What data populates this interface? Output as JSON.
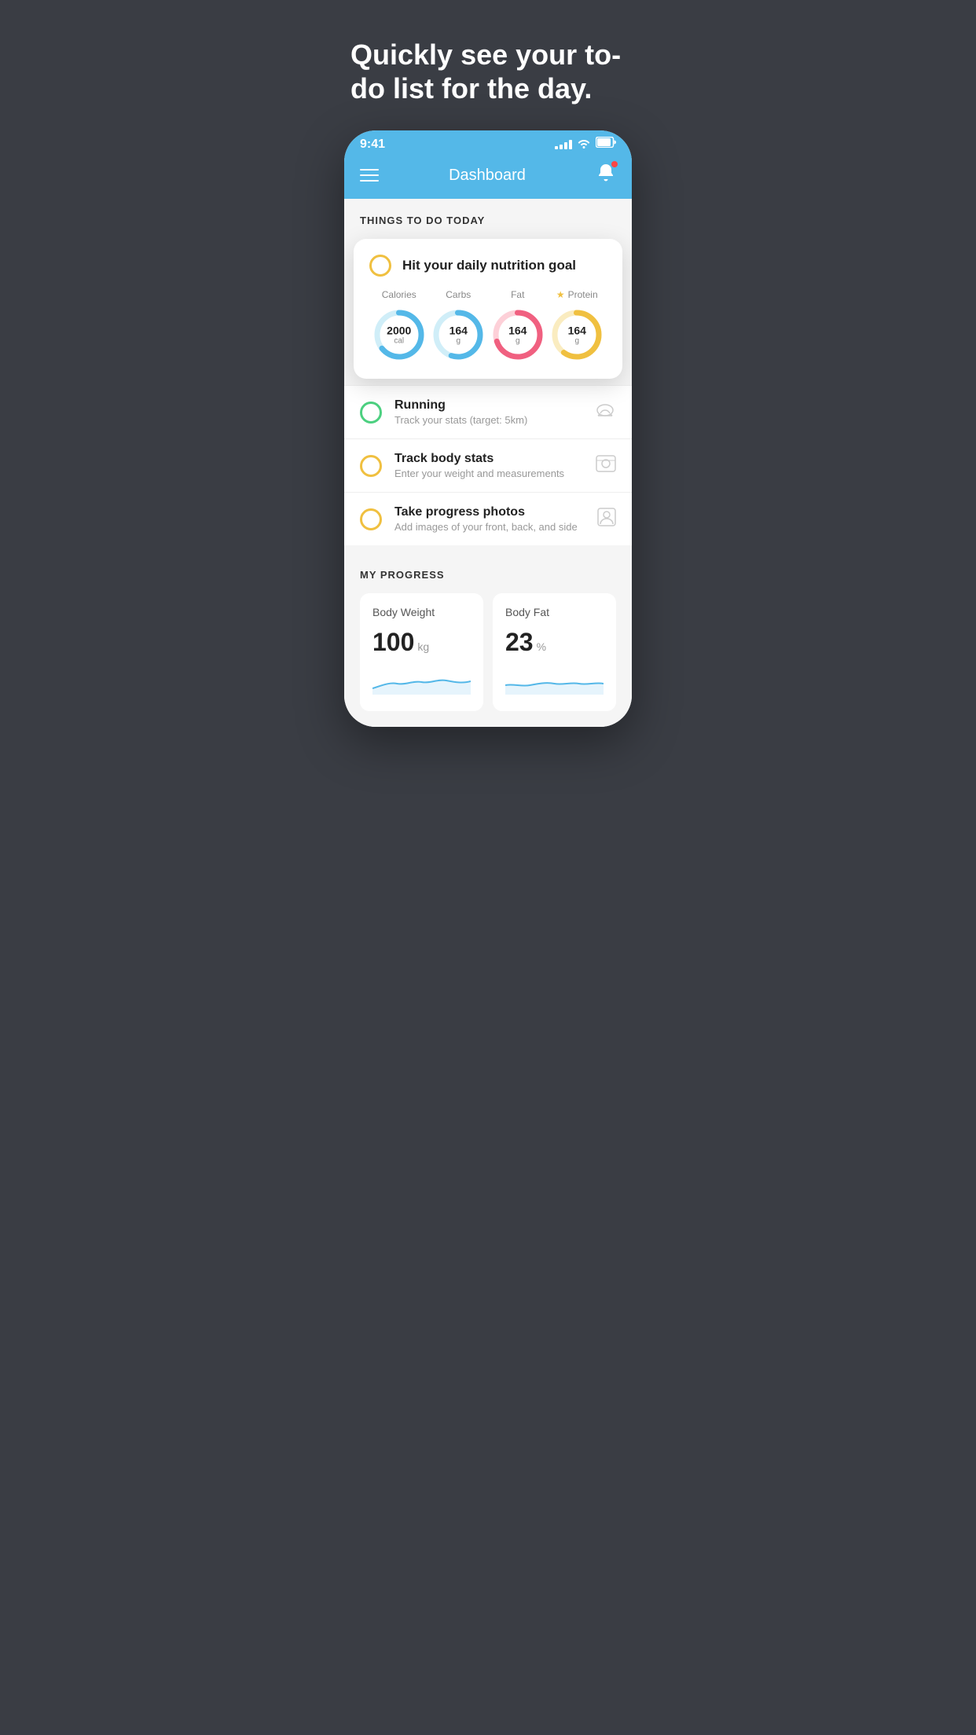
{
  "hero": {
    "title": "Quickly see your to-do list for the day."
  },
  "statusBar": {
    "time": "9:41",
    "signalBars": [
      3,
      5,
      7,
      9,
      11
    ],
    "battery": "■■■"
  },
  "nav": {
    "title": "Dashboard",
    "menuAriaLabel": "Menu",
    "bellAriaLabel": "Notifications"
  },
  "thingsToDo": {
    "sectionHeader": "THINGS TO DO TODAY",
    "floatingCard": {
      "checkboxColor": "yellow",
      "title": "Hit your daily nutrition goal",
      "items": [
        {
          "label": "Calories",
          "star": false,
          "value": "2000",
          "unit": "cal",
          "progress": 65,
          "color": "#54b8e8",
          "trackColor": "#d0eef8"
        },
        {
          "label": "Carbs",
          "star": false,
          "value": "164",
          "unit": "g",
          "progress": 55,
          "color": "#54b8e8",
          "trackColor": "#d0eef8"
        },
        {
          "label": "Fat",
          "star": false,
          "value": "164",
          "unit": "g",
          "progress": 70,
          "color": "#f06080",
          "trackColor": "#fdd0d8"
        },
        {
          "label": "Protein",
          "star": true,
          "value": "164",
          "unit": "g",
          "progress": 60,
          "color": "#f0c040",
          "trackColor": "#faecc0"
        }
      ]
    },
    "listItems": [
      {
        "id": "running",
        "checkboxColor": "green",
        "title": "Running",
        "subtitle": "Track your stats (target: 5km)",
        "icon": "👟"
      },
      {
        "id": "track-body-stats",
        "checkboxColor": "yellow",
        "title": "Track body stats",
        "subtitle": "Enter your weight and measurements",
        "icon": "⚖️"
      },
      {
        "id": "progress-photos",
        "checkboxColor": "yellow",
        "title": "Take progress photos",
        "subtitle": "Add images of your front, back, and side",
        "icon": "👤"
      }
    ]
  },
  "myProgress": {
    "sectionHeader": "MY PROGRESS",
    "cards": [
      {
        "title": "Body Weight",
        "value": "100",
        "unit": "kg"
      },
      {
        "title": "Body Fat",
        "value": "23",
        "unit": "%"
      }
    ]
  }
}
